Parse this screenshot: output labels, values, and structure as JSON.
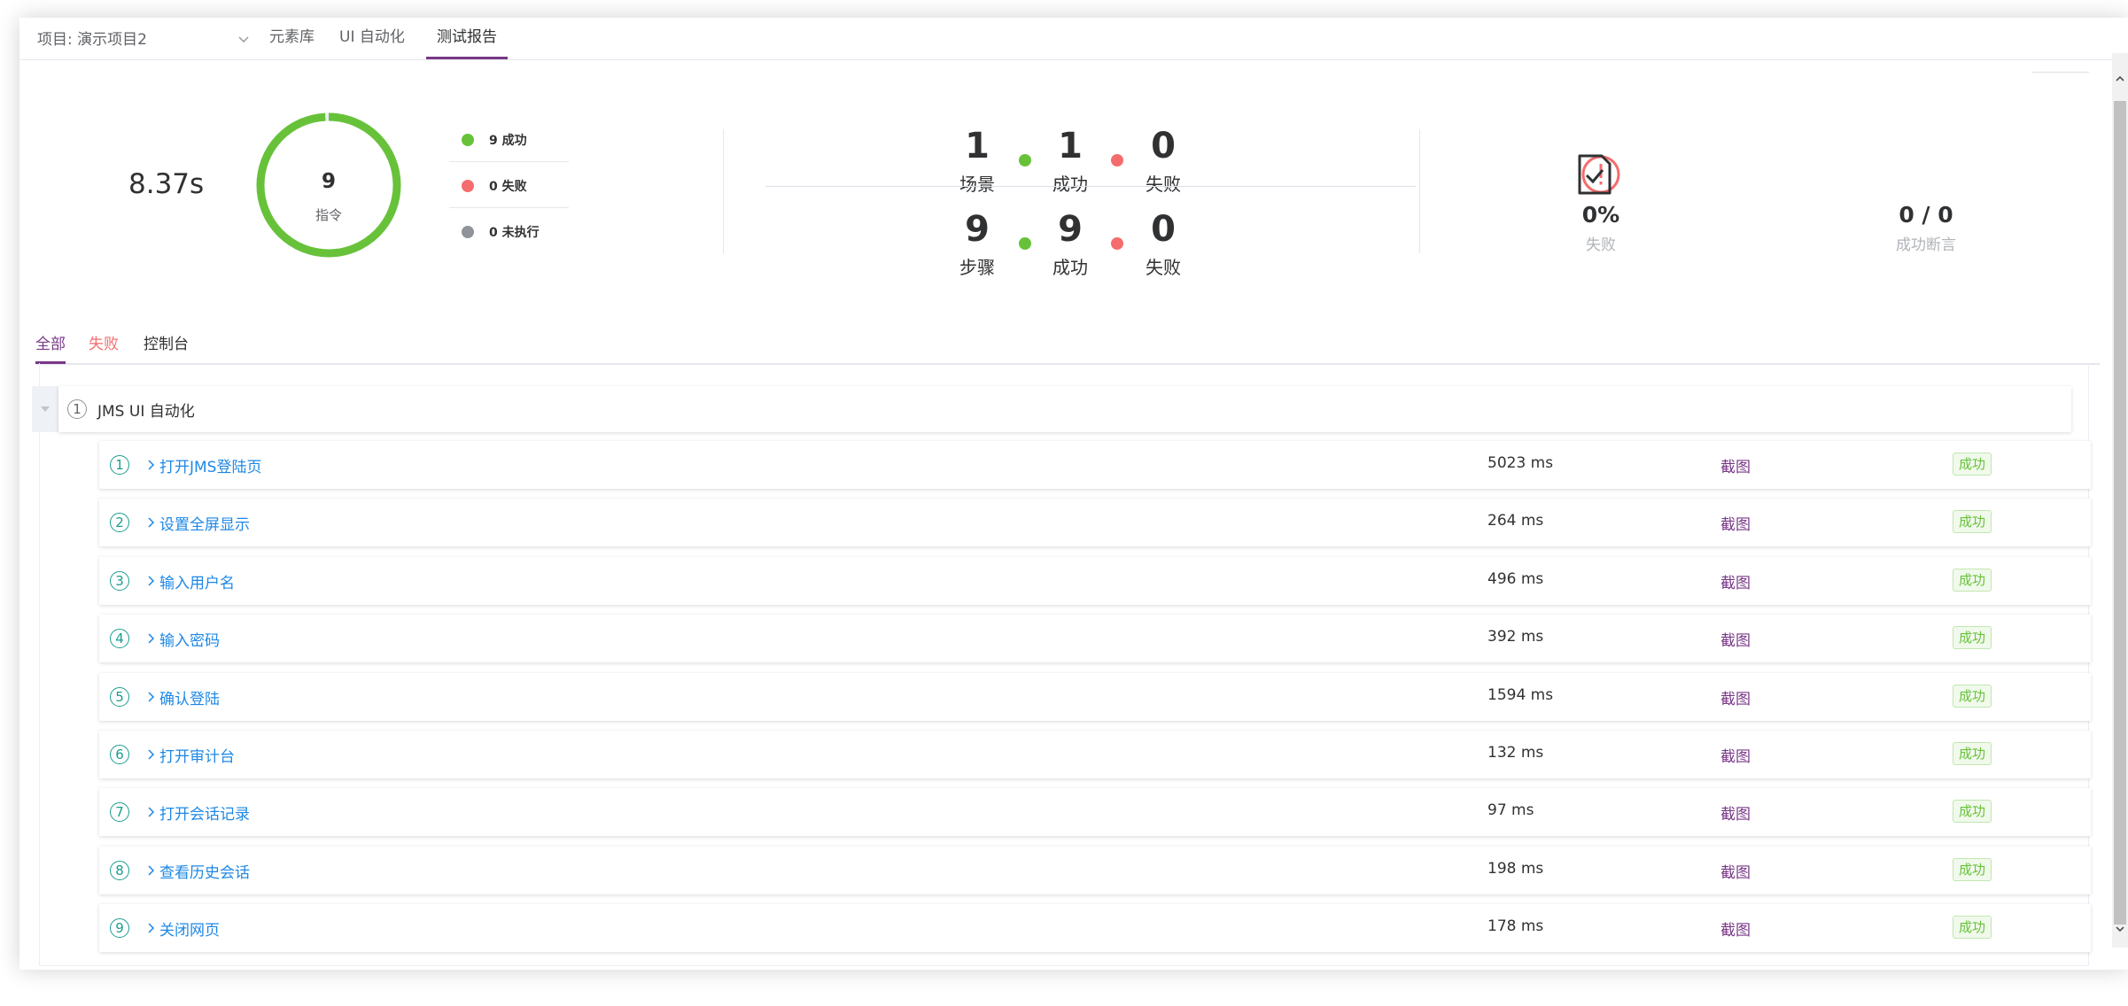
{
  "nav": {
    "project_label": "项目: 演示项目2",
    "menu": [
      "元素库",
      "UI 自动化",
      "测试报告"
    ]
  },
  "summary": {
    "duration": "8.37s",
    "total": "9",
    "total_label": "指令",
    "success_fraction": 1.0,
    "legend": [
      {
        "label": "9 成功",
        "color": "#67c23a"
      },
      {
        "label": "0 失败",
        "color": "#f56c6c"
      },
      {
        "label": "0 未执行",
        "color": "#909399"
      }
    ]
  },
  "counts": {
    "scenario": {
      "total": "1",
      "total_label": "场景",
      "success": "1",
      "success_label": "成功",
      "fail": "0",
      "fail_label": "失败"
    },
    "step": {
      "total": "9",
      "total_label": "步骤",
      "success": "9",
      "success_label": "成功",
      "fail": "0",
      "fail_label": "失败"
    }
  },
  "stats": {
    "fail_rate": {
      "value": "0%",
      "label": "失败",
      "icon": "exclamation-circle-icon"
    },
    "assertions": {
      "value": "0 / 0",
      "label": "成功断言",
      "icon": "document-check-icon"
    }
  },
  "tabs": [
    "全部",
    "失败",
    "控制台"
  ],
  "scenario": {
    "index": "1",
    "name": "JMS UI 自动化"
  },
  "steps": [
    {
      "index": "1",
      "name": "打开JMS登陆页",
      "time": "5023 ms",
      "shot": "截图",
      "status": "成功"
    },
    {
      "index": "2",
      "name": "设置全屏显示",
      "time": "264 ms",
      "shot": "截图",
      "status": "成功"
    },
    {
      "index": "3",
      "name": "输入用户名",
      "time": "496 ms",
      "shot": "截图",
      "status": "成功"
    },
    {
      "index": "4",
      "name": "输入密码",
      "time": "392 ms",
      "shot": "截图",
      "status": "成功"
    },
    {
      "index": "5",
      "name": "确认登陆",
      "time": "1594 ms",
      "shot": "截图",
      "status": "成功"
    },
    {
      "index": "6",
      "name": "打开审计台",
      "time": "132 ms",
      "shot": "截图",
      "status": "成功"
    },
    {
      "index": "7",
      "name": "打开会话记录",
      "time": "97 ms",
      "shot": "截图",
      "status": "成功"
    },
    {
      "index": "8",
      "name": "查看历史会话",
      "time": "198 ms",
      "shot": "截图",
      "status": "成功"
    },
    {
      "index": "9",
      "name": "关闭网页",
      "time": "178 ms",
      "shot": "截图",
      "status": "成功"
    }
  ],
  "colors": {
    "accent": "#783887",
    "success": "#67c23a",
    "fail": "#f56c6c",
    "link": "#1e88e5",
    "teal": "#1a9d8f"
  }
}
